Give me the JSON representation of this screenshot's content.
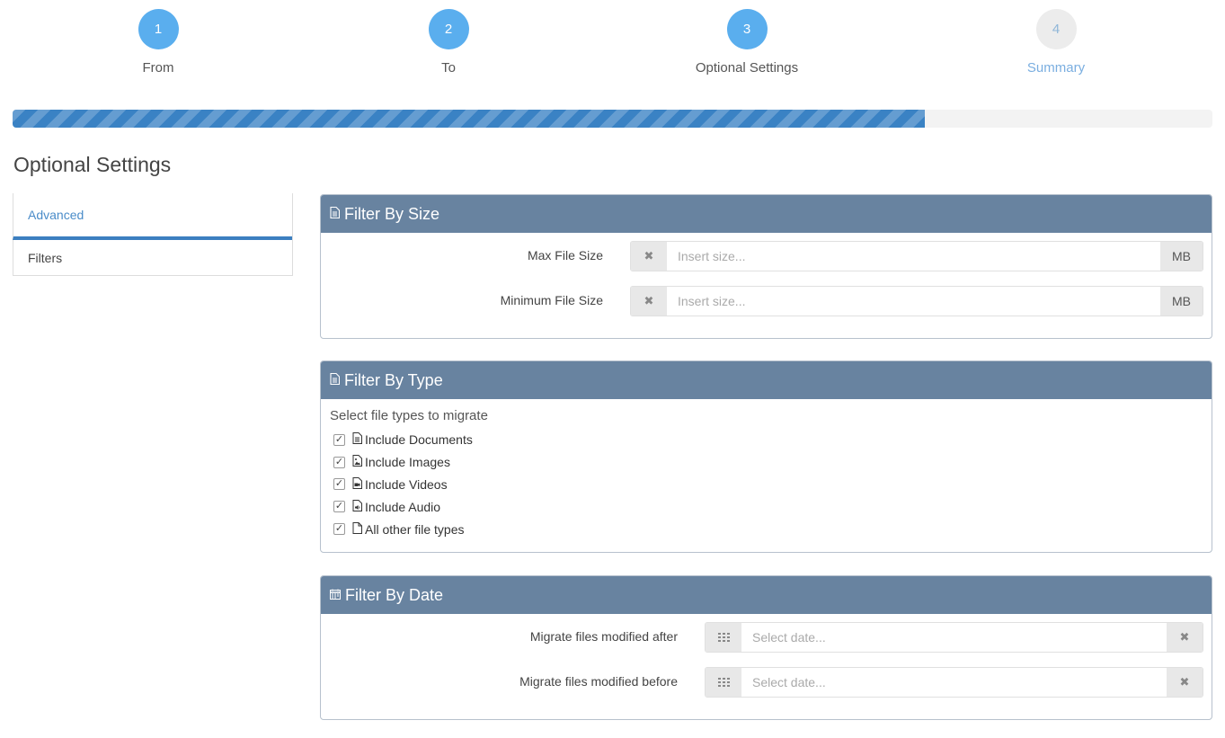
{
  "steps": [
    {
      "number": "1",
      "label": "From",
      "state": "done"
    },
    {
      "number": "2",
      "label": "To",
      "state": "done"
    },
    {
      "number": "3",
      "label": "Optional Settings",
      "state": "current"
    },
    {
      "number": "4",
      "label": "Summary",
      "state": "pending"
    }
  ],
  "progress": {
    "percent": 76
  },
  "page_title": "Optional Settings",
  "sidenav": {
    "items": [
      {
        "label": "Advanced",
        "active": true
      },
      {
        "label": "Filters",
        "active": false
      }
    ]
  },
  "size_panel": {
    "title": "Filter By Size",
    "icon": "document-icon",
    "max": {
      "label": "Max File Size",
      "placeholder": "Insert size...",
      "unit": "MB",
      "value": ""
    },
    "min": {
      "label": "Minimum File Size",
      "placeholder": "Insert size...",
      "unit": "MB",
      "value": ""
    }
  },
  "type_panel": {
    "title": "Filter By Type",
    "icon": "document-icon",
    "hint": "Select file types to migrate",
    "options": [
      {
        "label": "Include Documents",
        "icon": "file-text-icon",
        "checked": true
      },
      {
        "label": "Include Images",
        "icon": "file-image-icon",
        "checked": true
      },
      {
        "label": "Include Videos",
        "icon": "file-video-icon",
        "checked": true
      },
      {
        "label": "Include Audio",
        "icon": "file-audio-icon",
        "checked": true
      },
      {
        "label": "All other file types",
        "icon": "file-blank-icon",
        "checked": true
      }
    ]
  },
  "date_panel": {
    "title": "Filter By Date",
    "icon": "calendar-icon",
    "after": {
      "label": "Migrate files modified after",
      "placeholder": "Select date..."
    },
    "before": {
      "label": "Migrate files modified before",
      "placeholder": "Select date..."
    }
  },
  "colors": {
    "step_active": "#5aaeee",
    "step_pending": "#ececec",
    "progress_fill": "#3a82c4",
    "panel_header": "#6883a0",
    "nav_active": "#4a8cc9"
  }
}
